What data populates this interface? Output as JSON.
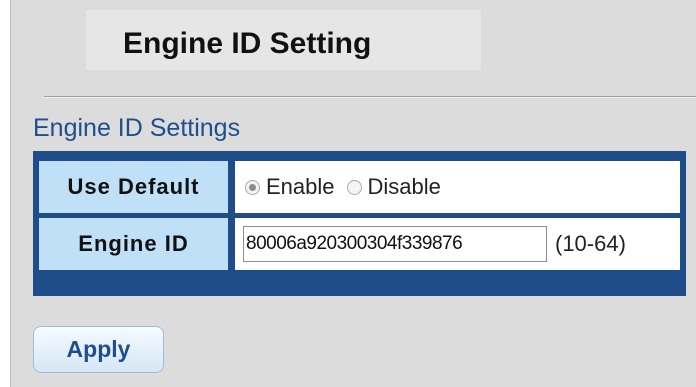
{
  "page": {
    "title": "Engine ID Setting"
  },
  "section": {
    "title": "Engine ID Settings"
  },
  "use_default": {
    "label": "Use Default",
    "options": [
      {
        "label": "Enable",
        "checked": true
      },
      {
        "label": "Disable",
        "checked": false
      }
    ]
  },
  "engine_id": {
    "label": "Engine ID",
    "value": "80006a920300304f339876",
    "range_hint": "(10-64)"
  },
  "actions": {
    "apply_label": "Apply"
  },
  "colors": {
    "panel_bg": "#dcdcdc",
    "table_border": "#1e4d8a",
    "label_cell_bg": "#bfe0f7",
    "section_title": "#1f4e8e"
  }
}
